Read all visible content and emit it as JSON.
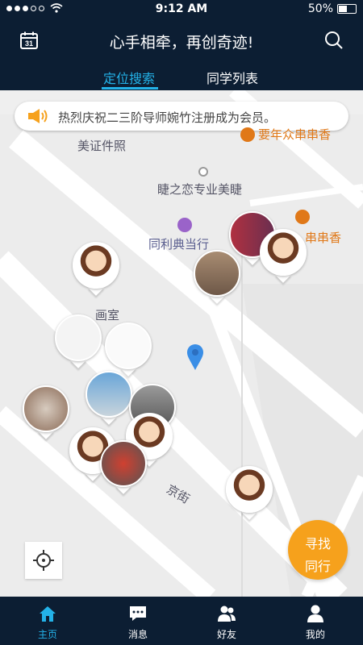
{
  "status": {
    "time": "9:12 AM",
    "battery": "50%",
    "battery_level": 0.5
  },
  "header": {
    "title": "心手相牵，再创奇迹!"
  },
  "tabs": [
    {
      "label": "定位搜索"
    },
    {
      "label": "同学列表"
    }
  ],
  "banner": {
    "text": "热烈庆祝二三阶导师婉竹注册成为会员。"
  },
  "map": {
    "pois": [
      {
        "label": "美证件照"
      },
      {
        "label": "睫之恋专业美睫"
      },
      {
        "label": "同利典当行"
      },
      {
        "label": "串串香"
      },
      {
        "label": "要年众串串香"
      },
      {
        "label": "画室"
      },
      {
        "label": "京街"
      }
    ]
  },
  "find_button": {
    "line1": "寻找",
    "line2": "同行"
  },
  "nav": [
    {
      "label": "主页",
      "icon": "home-icon"
    },
    {
      "label": "消息",
      "icon": "message-icon"
    },
    {
      "label": "好友",
      "icon": "friends-icon"
    },
    {
      "label": "我的",
      "icon": "profile-icon"
    }
  ],
  "colors": {
    "primary": "#0c1e33",
    "accent": "#23b2e8",
    "orange": "#f6a11c"
  }
}
